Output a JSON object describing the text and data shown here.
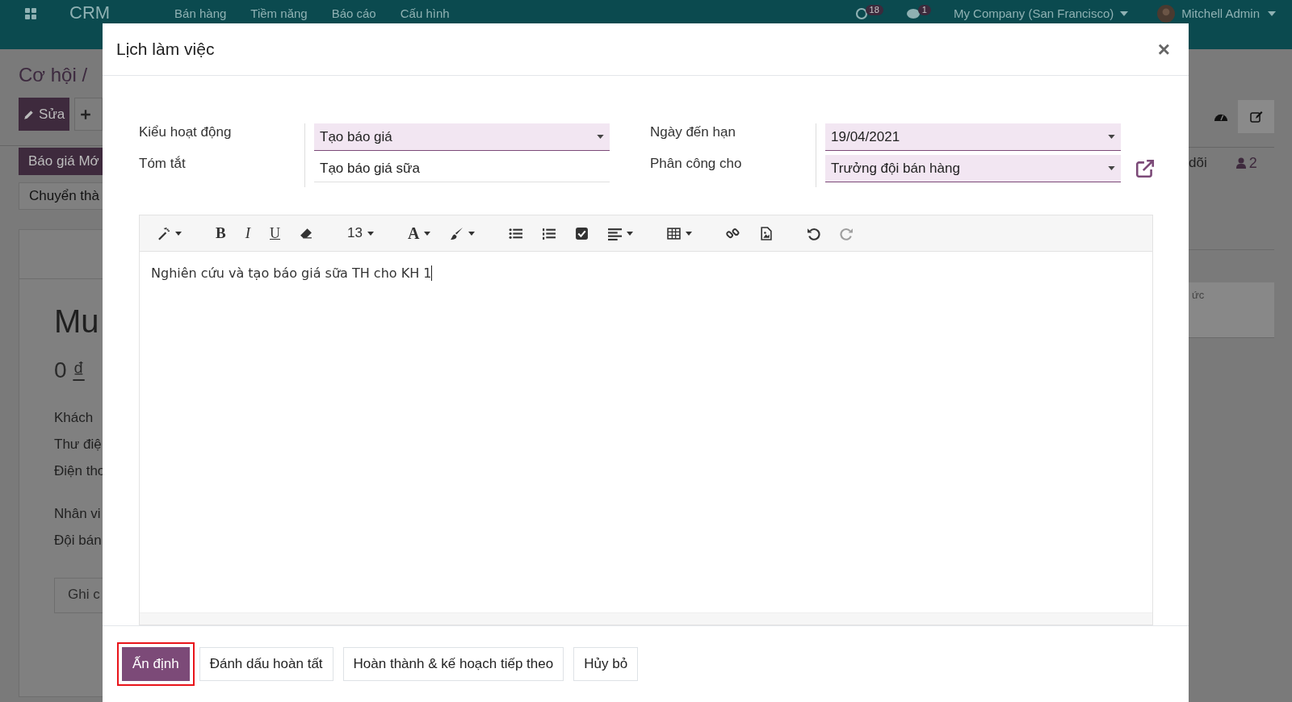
{
  "topbar": {
    "app": "CRM",
    "nav": [
      "Bán hàng",
      "Tiềm năng",
      "Báo cáo",
      "Cấu hình"
    ],
    "activity_count": "18",
    "message_count": "1",
    "company": "My Company (San Francisco)",
    "user": "Mitchell Admin"
  },
  "background": {
    "breadcrumb": "Cơ hội /",
    "edit_button": "Sửa",
    "quote_button": "Báo giá Mớ",
    "convert_button": "Chuyển thà",
    "title": "Mu",
    "amount": "0",
    "currency": "₫",
    "labels": [
      "Khách",
      "Thư điệ",
      "Điện tho",
      "Nhân vi",
      "Đội bán"
    ],
    "notes_tab": "Ghi c",
    "followers_label": "dõi",
    "followers_count": "2",
    "faded_text": "ức"
  },
  "dialog": {
    "title": "Lịch làm việc",
    "close": "×",
    "fields": [
      {
        "label": "Kiểu hoạt động",
        "value": "Tạo báo giá",
        "required": true,
        "dropdown": true
      },
      {
        "label": "Tóm tắt",
        "value": "Tạo báo giá sữa",
        "required": false,
        "dropdown": false
      },
      {
        "label": "Ngày đến hạn",
        "value": "19/04/2021",
        "required": true,
        "dropdown": true
      },
      {
        "label": "Phân công cho",
        "value": "Trưởng đội bán hàng",
        "required": true,
        "dropdown": true,
        "external_link": true
      }
    ],
    "toolbar": [
      [
        {
          "kind": "icon",
          "disabled": false
        }
      ],
      [
        {
          "kind": "text",
          "label": "B",
          "disabled": false
        },
        {
          "kind": "text",
          "label": "I",
          "disabled": false
        },
        {
          "kind": "text",
          "label": "U",
          "disabled": false
        },
        {
          "kind": "icon",
          "disabled": false
        }
      ],
      [
        {
          "kind": "text",
          "label": "13",
          "disabled": false
        }
      ],
      [
        {
          "kind": "text",
          "label": "A",
          "disabled": false
        },
        {
          "kind": "icon",
          "disabled": false
        }
      ],
      [
        {
          "kind": "icon",
          "disabled": false
        },
        {
          "kind": "icon",
          "disabled": false
        },
        {
          "kind": "icon",
          "disabled": false
        },
        {
          "kind": "icon",
          "disabled": false
        }
      ],
      [
        {
          "kind": "icon",
          "disabled": false
        }
      ],
      [
        {
          "kind": "icon",
          "disabled": false
        },
        {
          "kind": "icon",
          "disabled": false
        }
      ],
      [
        {
          "kind": "icon",
          "disabled": false
        },
        {
          "kind": "icon",
          "disabled": true
        }
      ]
    ],
    "note": "Nghiên cứu và tạo báo giá sữa TH cho KH 1",
    "buttons": [
      {
        "label": "Ấn định",
        "kind": "primary",
        "highlighted": true
      },
      {
        "label": "Đánh dấu hoàn tất",
        "kind": "secondary",
        "highlighted": false
      },
      {
        "label": "Hoàn thành & kế hoạch tiếp theo",
        "kind": "secondary",
        "highlighted": false
      },
      {
        "label": "Hủy bỏ",
        "kind": "secondary",
        "highlighted": false
      }
    ]
  }
}
